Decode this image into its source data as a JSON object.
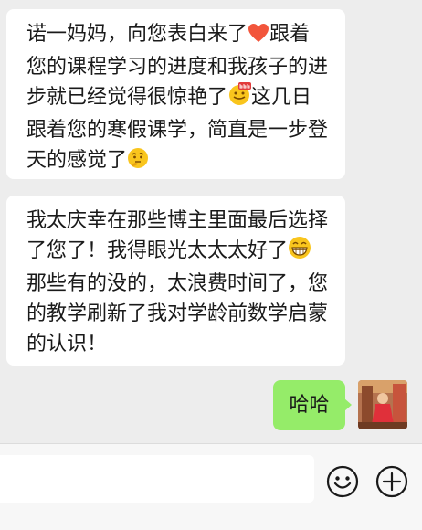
{
  "messages": [
    {
      "side": "left",
      "lines": [
        [
          "诺一妈妈，向您表白来了",
          "[heart-emoji]",
          "跟着"
        ],
        [
          "您的课程学习的进度和我孩子的进"
        ],
        [
          "步就已经觉得很惊艳了",
          "[666-emoji]",
          "这几日"
        ],
        [
          "跟着您的寒假课学，简直是一步登"
        ],
        [
          "天的感觉了",
          "[thinking-emoji]"
        ]
      ]
    },
    {
      "side": "left",
      "lines": [
        [
          "我太庆幸在那些博主里面最后选择"
        ],
        [
          "了您了！我得眼光太太太好了",
          "[grin-emoji]"
        ],
        [
          "那些有的没的，太浪费时间了，您"
        ],
        [
          "的教学刷新了我对学龄前数学启蒙"
        ],
        [
          "的认识！"
        ]
      ]
    }
  ],
  "m1": {
    "l1a": "诺一妈妈，向您表白来了",
    "l1b": "跟着",
    "l2": "您的课程学习的进度和我孩子的进",
    "l3a": "步就已经觉得很惊艳了",
    "l3b": "这几日",
    "l4": "跟着您的寒假课学，简直是一步登",
    "l5": "天的感觉了"
  },
  "m2": {
    "l1": "我太庆幸在那些博主里面最后选择",
    "l2": "了您了！我得眼光太太太好了",
    "l3": "那些有的没的，太浪费时间了，您",
    "l4": "的教学刷新了我对学龄前数学启蒙",
    "l5": "的认识！"
  },
  "sent": {
    "text": "哈哈"
  },
  "icons": {
    "emoji_button": "smiley-face-icon",
    "plus_button": "plus-circle-icon",
    "heart": "heart-emoji-icon",
    "six": "666-emoji-icon",
    "thinking": "thinking-emoji-icon",
    "grin": "grinning-emoji-icon"
  },
  "colors": {
    "sent_bubble": "#95ec69",
    "received_bubble": "#ffffff",
    "background": "#ededed"
  }
}
